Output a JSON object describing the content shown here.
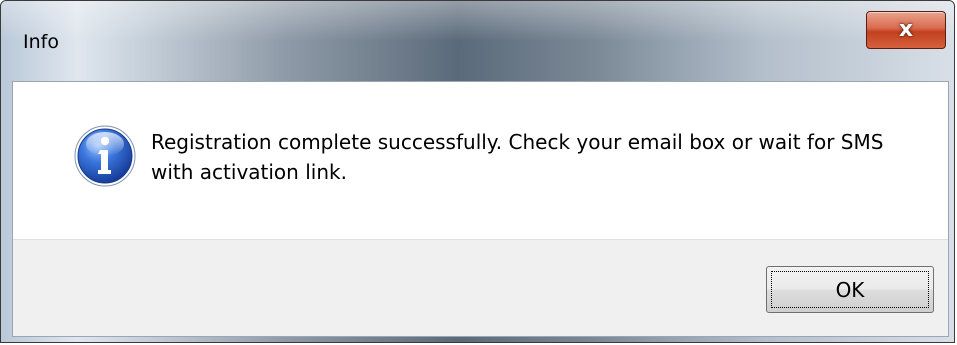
{
  "dialog": {
    "title": "Info",
    "close_label": "x",
    "message": "Registration complete successfully. Check your email box or wait for SMS with activation link.",
    "icon": "info-icon",
    "ok_label": "OK"
  },
  "colors": {
    "close_button": "#c2411f",
    "icon_blue": "#2a5fc4",
    "footer_bg": "#f0f0f0"
  }
}
